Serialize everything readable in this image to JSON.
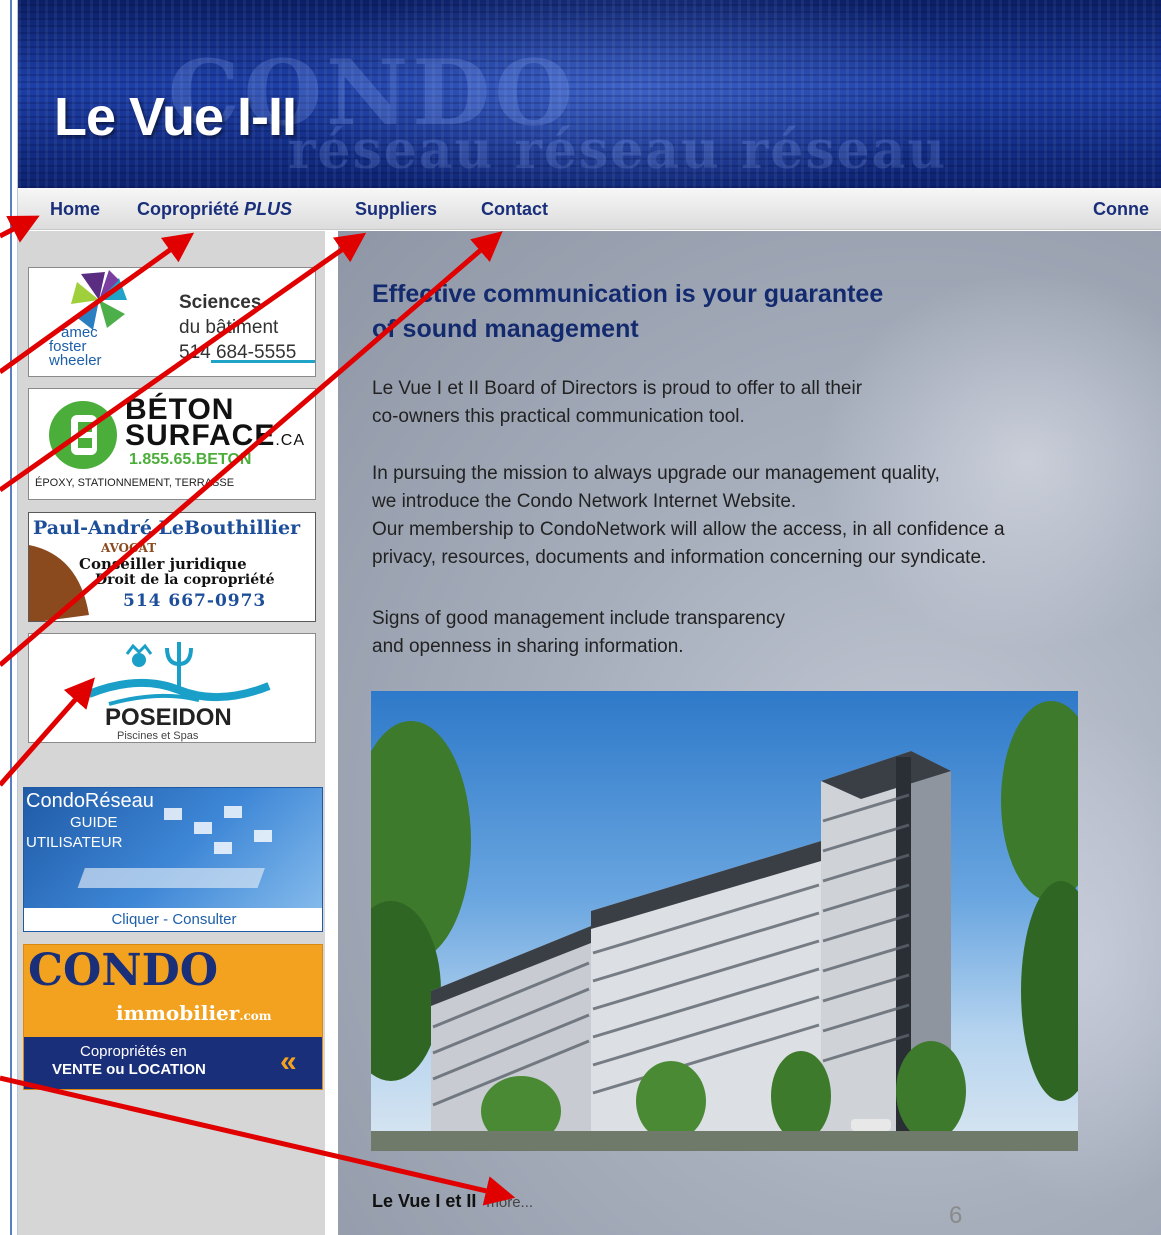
{
  "site": {
    "title": "Le Vue I-II",
    "banner_watermark_1": "CONDO",
    "banner_watermark_2": "réseau réseau réseau"
  },
  "nav": {
    "home": "Home",
    "copropriete": "Copropriété",
    "copropriete_plus": "PLUS",
    "suppliers": "Suppliers",
    "contact": "Contact",
    "connect": "Conne"
  },
  "ads": {
    "amec": {
      "brand_line1": "amec",
      "brand_line2": "foster",
      "brand_line3": "wheeler",
      "text1": "Sciences",
      "text2": "du bâtiment",
      "phone": "514 684-5555"
    },
    "beton": {
      "line1": "BÉTON",
      "line2": "SURFACE",
      "suffix": ".CA",
      "phone": "1.855.65.BETON",
      "tagline": "ÉPOXY, STATIONNEMENT, TERRASSE"
    },
    "lawyer": {
      "name": "Paul-André LeBouthillier",
      "title": "AVOCAT",
      "line1": "Conseiller juridique",
      "line2": "Droit de la copropriété",
      "phone": "514 667-0973"
    },
    "poseidon": {
      "name": "POSEIDON",
      "tagline": "Piscines et Spas"
    },
    "guide": {
      "line1": "CondoRéseau",
      "line2": "GUIDE",
      "line3": "UTILISATEUR",
      "link": "Cliquer - Consulter"
    },
    "condo_immo": {
      "line1": "CONDO",
      "line2": "immobilier",
      "suffix": ".com",
      "line3": "Copropriétés en",
      "line4": "VENTE ou LOCATION",
      "arrow": "«"
    }
  },
  "content": {
    "headline": "Effective communication is your guarantee of sound management",
    "p1_line1": "Le Vue I et II Board of Directors is proud to offer to all their",
    "p1_line2": "co-owners this practical communication tool.",
    "p2_line1": "In pursuing the mission to always upgrade our management quality,",
    "p2_line2": "we introduce the Condo Network Internet Website.",
    "p2_line3": "Our membership to CondoNetwork will allow the access, in all confidence a",
    "p2_line4": "privacy, resources, documents and information concerning our syndicate.",
    "p3_line1": "Signs of good management include transparency",
    "p3_line2": "and openness in sharing information.",
    "caption": "Le Vue I et II",
    "more": "more..."
  },
  "page_number": "6",
  "colors": {
    "nav_text": "#1a2f7a",
    "annotation_arrow": "#e00000",
    "banner": "#1d3fa6"
  }
}
